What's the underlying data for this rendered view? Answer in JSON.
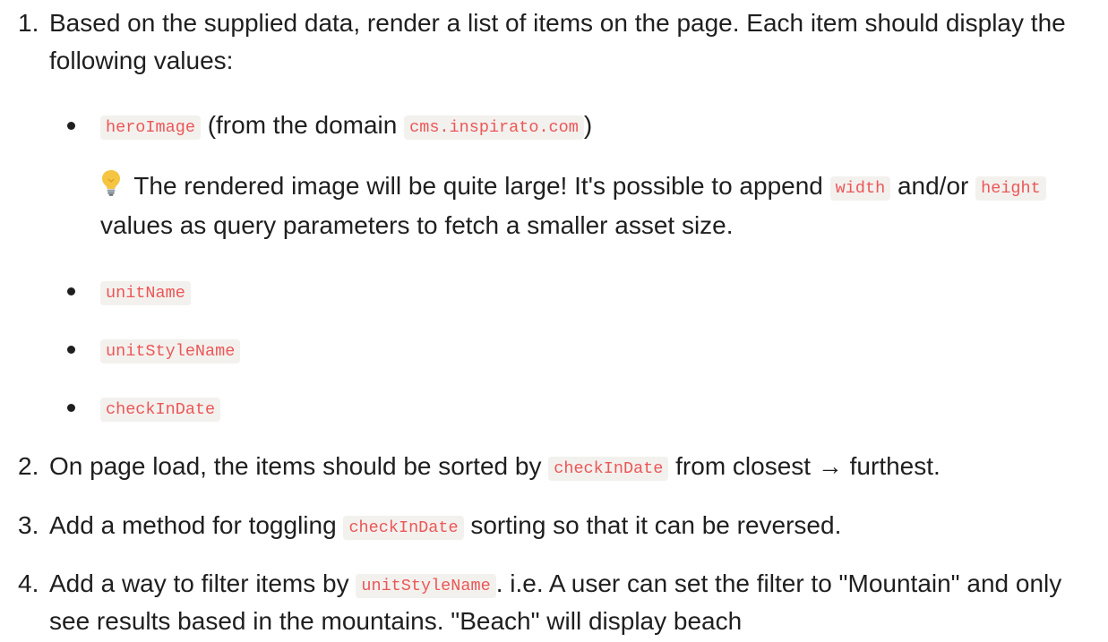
{
  "list": {
    "item1": {
      "number": "1.",
      "text_a": "Based on the supplied data, render a list of items on the page. Each item should display the following values:",
      "sub": [
        {
          "code": "heroImage",
          "text_mid": " (from the domain ",
          "code2": "cms.inspirato.com",
          "text_end": ")",
          "note": {
            "icon": "lightbulb-icon",
            "text_a": " The rendered image will be quite large! It's possible to append ",
            "code_a": "width",
            "text_b": " and/or ",
            "code_b": "height",
            "text_c": " values as query parameters to fetch a smaller asset size."
          }
        },
        {
          "code": "unitName"
        },
        {
          "code": "unitStyleName"
        },
        {
          "code": "checkInDate"
        }
      ]
    },
    "item2": {
      "number": "2.",
      "text_a": "On page load, the items should be sorted by ",
      "code": "checkInDate",
      "text_b": " from closest → furthest."
    },
    "item3": {
      "number": "3.",
      "text_a": "Add a method for toggling ",
      "code": "checkInDate",
      "text_b": " sorting so that it can be reversed."
    },
    "item4": {
      "number": "4.",
      "text_a": "Add a way to filter items by ",
      "code": "unitStyleName",
      "text_b": ". i.e. A user can set the filter to \"Mountain\" and only see results based in the mountains. \"Beach\" will display beach"
    }
  },
  "colors": {
    "text": "#1f1f1f",
    "code_text": "#eb5757",
    "code_bg": "#f3f1ee",
    "bulb": "#f5c542"
  }
}
